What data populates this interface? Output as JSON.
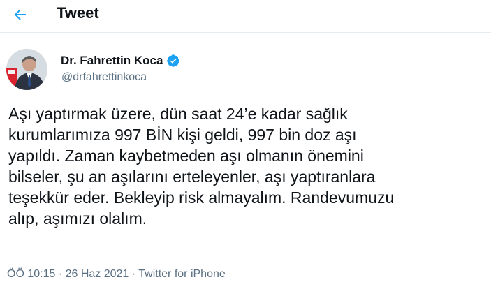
{
  "header": {
    "title": "Tweet",
    "back_icon": "arrow-left-icon",
    "accent_color": "#1da1f2"
  },
  "author": {
    "display_name": "Dr. Fahrettin Koca",
    "handle": "@drfahrettinkoca",
    "verified_icon": "verified-badge-icon",
    "verified_color": "#1da1f2"
  },
  "tweet": {
    "lines": [
      "Aşı yaptırmak üzere, dün saat 24’e kadar sağlık",
      "kurumlarımıza 997 BİN kişi geldi, 997 bin doz aşı",
      "yapıldı. Zaman kaybetmeden aşı olmanın önemini",
      "bilseler, şu an aşılarını erteleyenler, aşı yaptıranlara",
      "teşekkür eder. Bekleyip risk almayalım. Randevumuzu",
      "alıp, aşımızı olalım."
    ]
  },
  "meta": {
    "time": "ÖÖ 10:15",
    "separator": " · ",
    "date": "26 Haz 2021",
    "source": "Twitter for iPhone"
  }
}
